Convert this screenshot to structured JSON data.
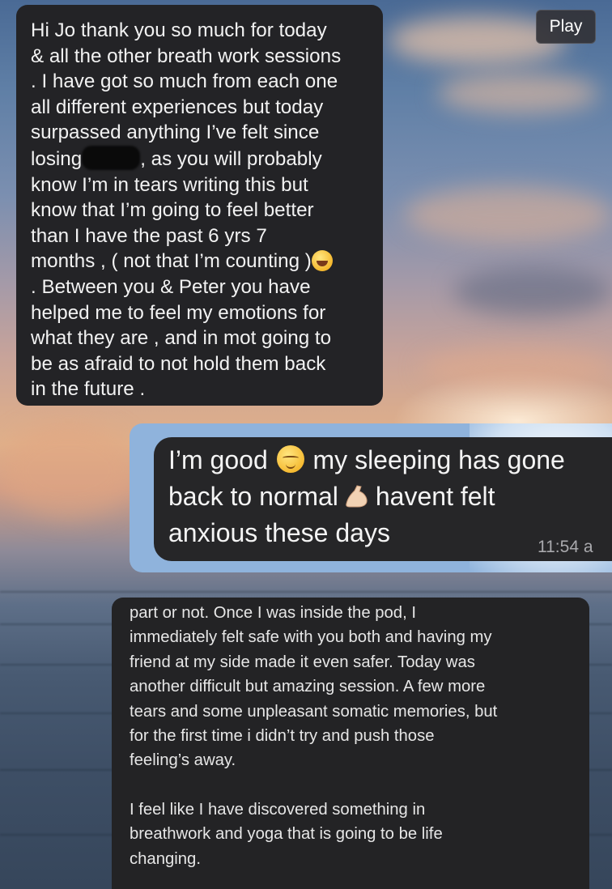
{
  "overlay": {
    "play_label": "Play"
  },
  "message1": {
    "lines": [
      "Hi Jo thank you so much for today",
      "& all the other breath work sessions",
      ". I have got so much from each one",
      "all different experiences but today",
      "surpassed anything I’ve felt since",
      "losing",
      ", as you will probably",
      "know I’m in tears writing this but",
      "know that I’m going to feel better",
      "than I have the past 6 yrs 7",
      "months , ( not that I’m counting )",
      ". Between you & Peter you have",
      "helped me to feel my emotions for",
      "what they are , and in mot going to",
      "be as afraid to not hold them back",
      "in the future ."
    ],
    "emoji": "face-with-tears-of-joy-icon"
  },
  "message2": {
    "line1_a": "I’m good",
    "line1_b": "my sleeping has gone",
    "line2_a": "back to normal",
    "line2_b": "havent felt",
    "line3": "anxious these days",
    "time": "11:54 a",
    "emoji_1": "relieved-face-icon",
    "emoji_2": "flexed-biceps-icon"
  },
  "message3": {
    "lines": [
      "part or not. Once I was inside the pod, I",
      "immediately felt safe with you both and having my",
      "friend at my side made it even safer. Today was",
      "another difficult but amazing session. A few more",
      "tears and some unpleasant somatic memories, but",
      "for the first time i didn’t try and push those",
      "feeling’s away.",
      "I feel like I have discovered something in",
      "breathwork and yoga that is going to be life",
      "changing."
    ]
  }
}
